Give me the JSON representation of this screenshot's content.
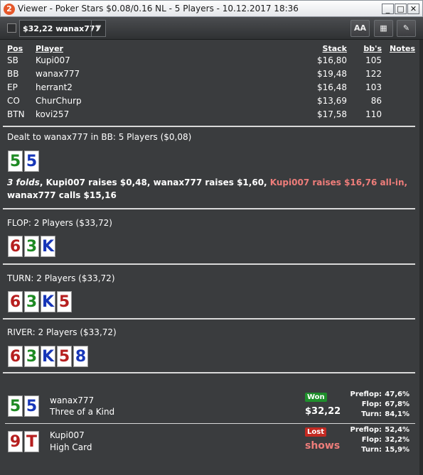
{
  "window": {
    "icon_text": "2",
    "title": "Viewer - Poker Stars $0.08/0.16 NL - 5 Players - 10.12.2017 18:36",
    "minimize": "_",
    "maximize": "□",
    "close": "✕"
  },
  "toolbar": {
    "hand_select_value": "$32,22 wanax777",
    "hand_select_arrow": "▼",
    "font_button": "AA",
    "grid_button": "▦",
    "edit_button": "✎"
  },
  "players_table": {
    "headers": {
      "pos": "Pos",
      "player": "Player",
      "stack": "Stack",
      "bbs": "bb's",
      "notes": "Notes"
    },
    "rows": [
      {
        "pos": "SB",
        "player": "Kupi007",
        "stack": "$16,80",
        "bbs": "105"
      },
      {
        "pos": "BB",
        "player": "wanax777",
        "stack": "$19,48",
        "bbs": "122"
      },
      {
        "pos": "EP",
        "player": "herrant2",
        "stack": "$16,48",
        "bbs": "103"
      },
      {
        "pos": "CO",
        "player": "ChurChurp",
        "stack": "$13,69",
        "bbs": "86"
      },
      {
        "pos": "BTN",
        "player": "kovi257",
        "stack": "$17,58",
        "bbs": "110"
      }
    ]
  },
  "preflop": {
    "title": "Dealt to wanax777 in BB: 5 Players ($0,08)",
    "cards": [
      {
        "rank": "5",
        "color": "#1e8a23"
      },
      {
        "rank": "5",
        "color": "#1736b8"
      }
    ],
    "action_folds": "3 folds",
    "action_part1": ", Kupi007 raises $0,48, wanax777 raises $1,60, ",
    "action_allin": "Kupi007 raises $16,76 all-in,",
    "action_line2": "wanax777 calls $15,16"
  },
  "flop": {
    "title": "FLOP: 2 Players ($33,72)",
    "cards": [
      {
        "rank": "6",
        "color": "#b61f1f"
      },
      {
        "rank": "3",
        "color": "#1e8a23"
      },
      {
        "rank": "K",
        "color": "#1736b8"
      }
    ]
  },
  "turn": {
    "title": "TURN: 2 Players ($33,72)",
    "cards": [
      {
        "rank": "6",
        "color": "#b61f1f"
      },
      {
        "rank": "3",
        "color": "#1e8a23"
      },
      {
        "rank": "K",
        "color": "#1736b8"
      },
      {
        "rank": "5",
        "color": "#b61f1f"
      }
    ]
  },
  "river": {
    "title": "RIVER: 2 Players ($33,72)",
    "cards": [
      {
        "rank": "6",
        "color": "#b61f1f"
      },
      {
        "rank": "3",
        "color": "#1e8a23"
      },
      {
        "rank": "K",
        "color": "#1736b8"
      },
      {
        "rank": "5",
        "color": "#b61f1f"
      },
      {
        "rank": "8",
        "color": "#1736b8"
      }
    ]
  },
  "showdown": [
    {
      "player": "wanax777",
      "hand": "Three of a Kind",
      "cards": [
        {
          "rank": "5",
          "color": "#1e8a23"
        },
        {
          "rank": "5",
          "color": "#1736b8"
        }
      ],
      "badge": "Won",
      "amount": "$32,22",
      "equity": [
        {
          "label": "Preflop:",
          "value": "47,6%"
        },
        {
          "label": "Flop:",
          "value": "67,8%"
        },
        {
          "label": "Turn:",
          "value": "84,1%"
        }
      ]
    },
    {
      "player": "Kupi007",
      "hand": "High Card",
      "cards": [
        {
          "rank": "9",
          "color": "#b61f1f"
        },
        {
          "rank": "T",
          "color": "#b61f1f"
        }
      ],
      "badge": "Lost",
      "amount": "shows",
      "equity": [
        {
          "label": "Preflop:",
          "value": "52,4%"
        },
        {
          "label": "Flop:",
          "value": "32,2%"
        },
        {
          "label": "Turn:",
          "value": "15,9%"
        }
      ]
    }
  ],
  "colors": {
    "background": "#3a3c3e",
    "won": "#1f8f2c",
    "lost": "#c32a22",
    "allin_text": "#ee7d7a"
  }
}
